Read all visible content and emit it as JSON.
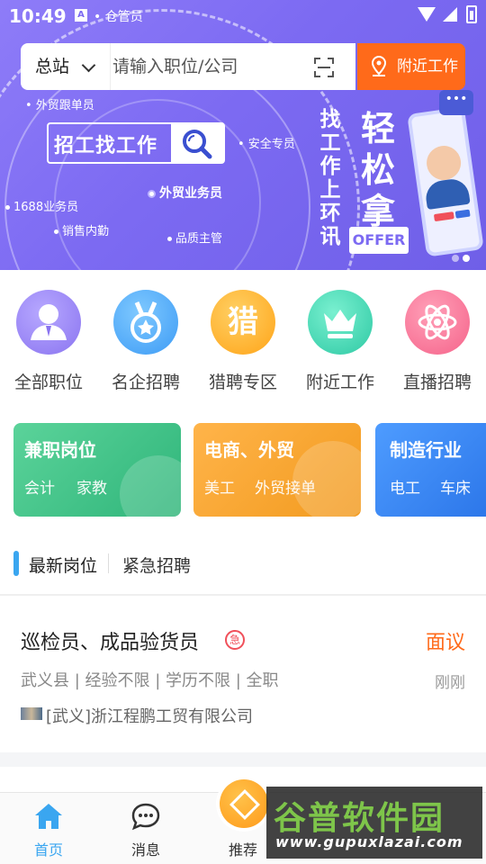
{
  "status_bar": {
    "time": "10:49",
    "a_badge": "A",
    "app_indicator": "• 仓管员"
  },
  "search": {
    "city": "总站",
    "placeholder": "请输入职位/公司",
    "nearby_label": "附近工作"
  },
  "banner": {
    "tags": [
      "• 外贸跟单员",
      "• 安全专员",
      "1688业务员",
      "外贸业务员",
      "销售内勤",
      "品质主管"
    ],
    "hire_text": "招工找工作",
    "slogan_small": [
      "找",
      "工",
      "作",
      "上",
      "环",
      "讯"
    ],
    "slogan_big": [
      "轻",
      "松",
      "拿"
    ],
    "offer_badge": "OFFER",
    "bubble": "•••"
  },
  "menu": [
    {
      "label": "全部职位",
      "icon": "person-icon"
    },
    {
      "label": "名企招聘",
      "icon": "medal-icon"
    },
    {
      "label": "猎聘专区",
      "icon": "hunt-icon",
      "glyph": "猎"
    },
    {
      "label": "附近工作",
      "icon": "crown-icon"
    },
    {
      "label": "直播招聘",
      "icon": "atom-icon"
    }
  ],
  "cards": [
    {
      "title": "兼职岗位",
      "subs": [
        "会计",
        "家教"
      ],
      "color": "#3cc486"
    },
    {
      "title": "电商、外贸",
      "subs": [
        "美工",
        "外贸接单"
      ],
      "color": "#f5a52e"
    },
    {
      "title": "制造行业",
      "subs": [
        "电工",
        "车床"
      ],
      "color": "#3a86f2"
    }
  ],
  "tabs": {
    "latest": "最新岗位",
    "urgent": "紧急招聘"
  },
  "job": {
    "title": "巡检员、成品验货员",
    "urgent_badge": "急",
    "salary": "面议",
    "meta": "武义县 | 经验不限 | 学历不限 | 全职",
    "time": "刚刚",
    "company": "[武义]浙江程鹏工贸有限公司"
  },
  "bottom_nav": [
    {
      "label": "首页",
      "icon": "home-icon",
      "active": true
    },
    {
      "label": "消息",
      "icon": "chat-icon",
      "active": false
    },
    {
      "label": "推荐",
      "icon": "recommend-icon",
      "active": false
    }
  ],
  "watermark": {
    "brand": "谷普软件园",
    "url": "www.gupuxlazai.com"
  },
  "colors": {
    "accent": "#3aa6f0",
    "orange": "#ff6a1a",
    "banner": "#7c6af2"
  }
}
